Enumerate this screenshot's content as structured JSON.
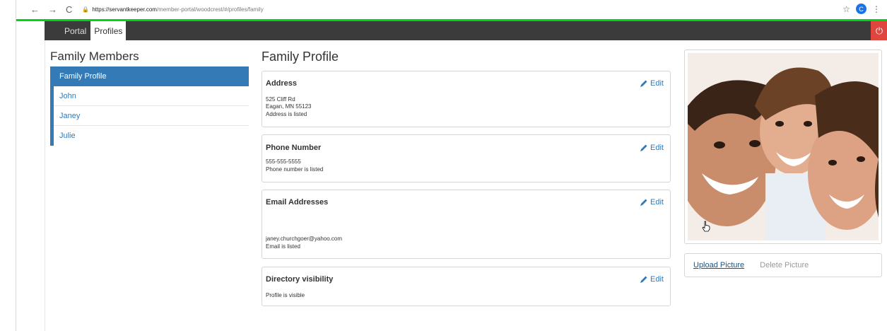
{
  "browser": {
    "url_host": "https://servantkeeper.com",
    "url_path": "/member-portal/woodcrest/#/profiles/family",
    "profile_initial": "C",
    "back_glyph": "←",
    "forward_glyph": "→",
    "reload_glyph": "C",
    "star_glyph": "☆",
    "menu_glyph": "⋮"
  },
  "topnav": {
    "tabs": [
      {
        "label": "Portal",
        "active": false
      },
      {
        "label": "Profiles",
        "active": true
      }
    ],
    "power_glyph": "⏻",
    "power_color": "#e0463d"
  },
  "sidebar": {
    "title": "Family Members",
    "items": [
      {
        "label": "Family Profile",
        "active": true
      },
      {
        "label": "John"
      },
      {
        "label": "Janey"
      },
      {
        "label": "Julie"
      }
    ]
  },
  "main": {
    "title": "Family Profile",
    "edit_label": "Edit",
    "cards": {
      "address": {
        "title": "Address",
        "lines": [
          "525 Cliff Rd",
          "Eagan, MN 55123",
          "Address is listed"
        ]
      },
      "phone": {
        "title": "Phone Number",
        "lines": [
          "555-555-5555",
          "Phone number is listed"
        ]
      },
      "email": {
        "title": "Email Addresses",
        "lines": [
          "janey.churchgoer@yahoo.com",
          "Email is listed"
        ]
      },
      "directory": {
        "title": "Directory visibility",
        "lines": [
          "Profile is visible"
        ]
      }
    }
  },
  "picture": {
    "upload_label": "Upload Picture",
    "delete_label": "Delete Picture"
  },
  "colors": {
    "accent": "#337ab7",
    "green_bar": "#00d51a",
    "nav_bg": "#3b3b3b"
  }
}
